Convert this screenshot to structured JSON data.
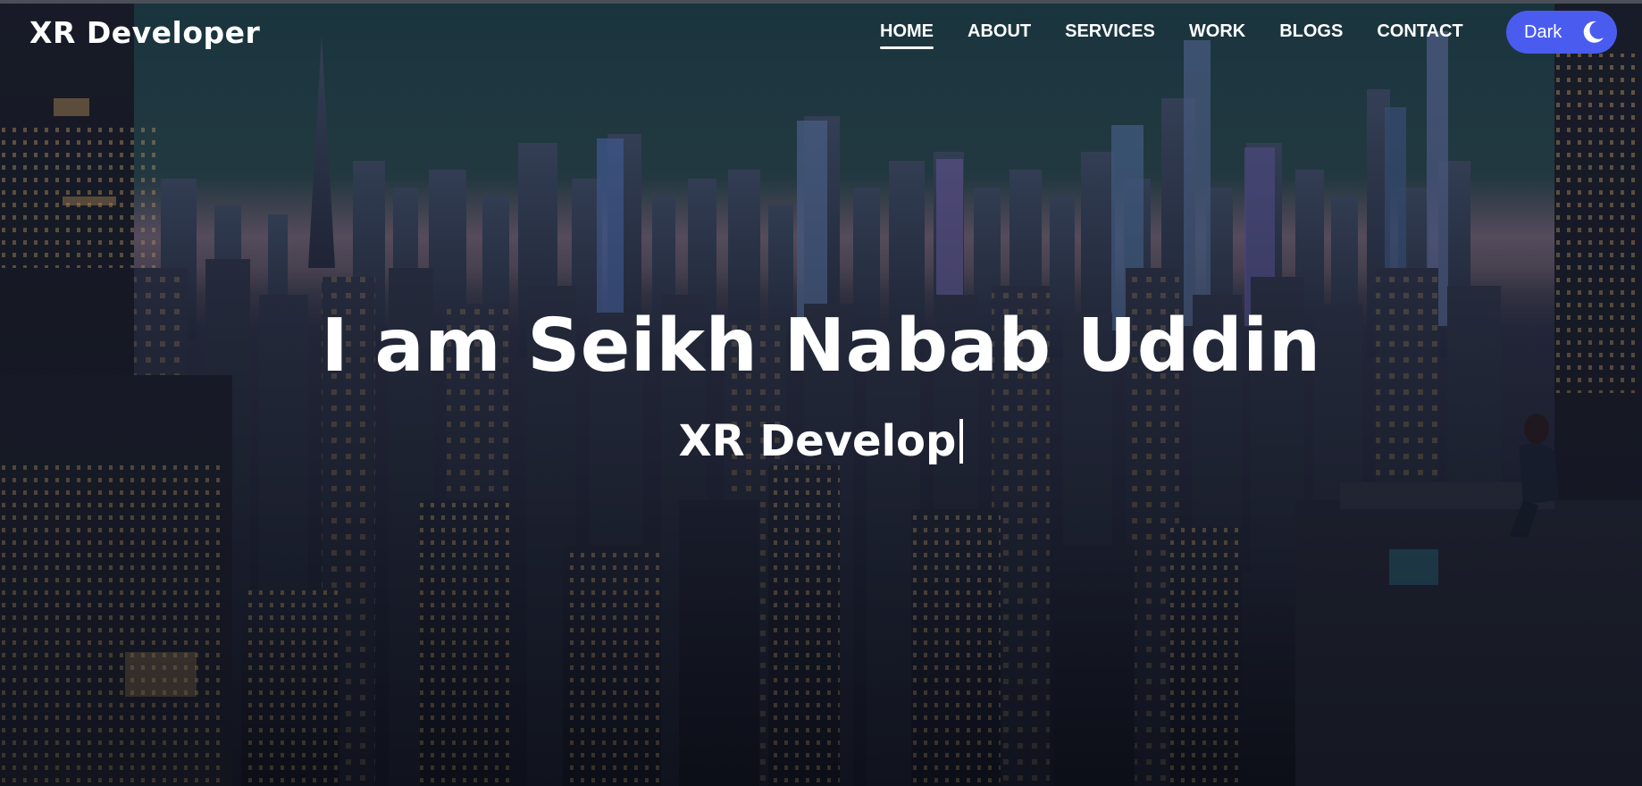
{
  "header": {
    "brand": "XR Developer",
    "nav": [
      {
        "label": "HOME",
        "active": true
      },
      {
        "label": "ABOUT",
        "active": false
      },
      {
        "label": "SERVICES",
        "active": false
      },
      {
        "label": "WORK",
        "active": false
      },
      {
        "label": "BLOGS",
        "active": false
      },
      {
        "label": "CONTACT",
        "active": false
      }
    ],
    "theme_toggle": {
      "label": "Dark",
      "icon": "moon-icon"
    }
  },
  "hero": {
    "title": "I am Seikh Nabab Uddin",
    "typed_text": "XR Develop",
    "background": "night-city-skyline-image"
  },
  "colors": {
    "toggle_bg": "#4a5cf0",
    "text": "#ffffff",
    "top_rule": "#4b4f58"
  }
}
